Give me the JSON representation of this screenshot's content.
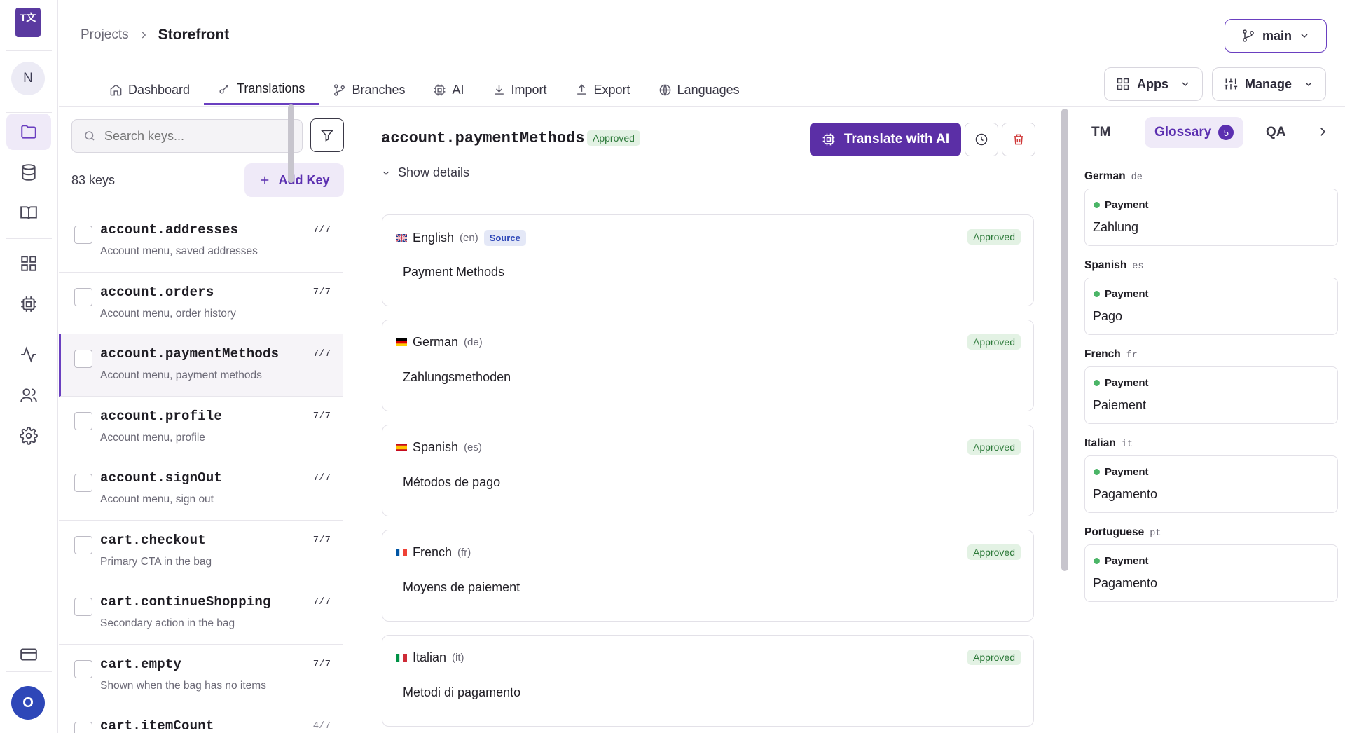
{
  "app": {
    "logo_text": "T文"
  },
  "rail": {
    "user_initial": "N",
    "bottom_initial": "O"
  },
  "header": {
    "breadcrumb": {
      "projects": "Projects",
      "current": "Storefront"
    },
    "branch": "main",
    "tabs": [
      {
        "label": "Dashboard",
        "icon": "home-icon"
      },
      {
        "label": "Translations",
        "icon": "translate-icon",
        "active": true
      },
      {
        "label": "Branches",
        "icon": "branch-icon"
      },
      {
        "label": "AI",
        "icon": "chip-icon"
      },
      {
        "label": "Import",
        "icon": "download-icon"
      },
      {
        "label": "Export",
        "icon": "upload-icon"
      },
      {
        "label": "Languages",
        "icon": "globe-icon"
      }
    ],
    "apps_label": "Apps",
    "manage_label": "Manage"
  },
  "keys": {
    "search_placeholder": "Search keys...",
    "count_label": "83 keys",
    "add_label": "Add Key",
    "items": [
      {
        "name": "account.addresses",
        "desc": "Account menu, saved addresses",
        "count": "7/7"
      },
      {
        "name": "account.orders",
        "desc": "Account menu, order history",
        "count": "7/7"
      },
      {
        "name": "account.paymentMethods",
        "desc": "Account menu, payment methods",
        "count": "7/7",
        "selected": true
      },
      {
        "name": "account.profile",
        "desc": "Account menu, profile",
        "count": "7/7"
      },
      {
        "name": "account.signOut",
        "desc": "Account menu, sign out",
        "count": "7/7"
      },
      {
        "name": "cart.checkout",
        "desc": "Primary CTA in the bag",
        "count": "7/7"
      },
      {
        "name": "cart.continueShopping",
        "desc": "Secondary action in the bag",
        "count": "7/7"
      },
      {
        "name": "cart.empty",
        "desc": "Shown when the bag has no items",
        "count": "7/7"
      },
      {
        "name": "cart.itemCount",
        "desc": "",
        "count": "4/7"
      }
    ]
  },
  "editor": {
    "key": "account.paymentMethods",
    "status": "Approved",
    "ai_label": "Translate with AI",
    "details_label": "Show details",
    "translations": [
      {
        "lang": "English",
        "code": "(en)",
        "source_label": "Source",
        "status": "Approved",
        "value": "Payment Methods",
        "flag": "gb"
      },
      {
        "lang": "German",
        "code": "(de)",
        "status": "Approved",
        "value": "Zahlungsmethoden",
        "flag": "de"
      },
      {
        "lang": "Spanish",
        "code": "(es)",
        "status": "Approved",
        "value": "Métodos de pago",
        "flag": "es"
      },
      {
        "lang": "French",
        "code": "(fr)",
        "status": "Approved",
        "value": "Moyens de paiement",
        "flag": "fr"
      },
      {
        "lang": "Italian",
        "code": "(it)",
        "status": "Approved",
        "value": "Metodi di pagamento",
        "flag": "it"
      }
    ]
  },
  "sidepanel": {
    "tabs": {
      "tm": "TM",
      "glossary": "Glossary",
      "glossary_count": "5",
      "qa": "QA"
    },
    "glossary": [
      {
        "lang": "German",
        "code": "de",
        "term": "Payment",
        "translation": "Zahlung"
      },
      {
        "lang": "Spanish",
        "code": "es",
        "term": "Payment",
        "translation": "Pago"
      },
      {
        "lang": "French",
        "code": "fr",
        "term": "Payment",
        "translation": "Paiement"
      },
      {
        "lang": "Italian",
        "code": "it",
        "term": "Payment",
        "translation": "Pagamento"
      },
      {
        "lang": "Portuguese",
        "code": "pt",
        "term": "Payment",
        "translation": "Pagamento"
      }
    ]
  },
  "colors": {
    "accent": "#6a3fc0",
    "approved_bg": "#e3f2e4",
    "approved_fg": "#2d7a3a"
  }
}
